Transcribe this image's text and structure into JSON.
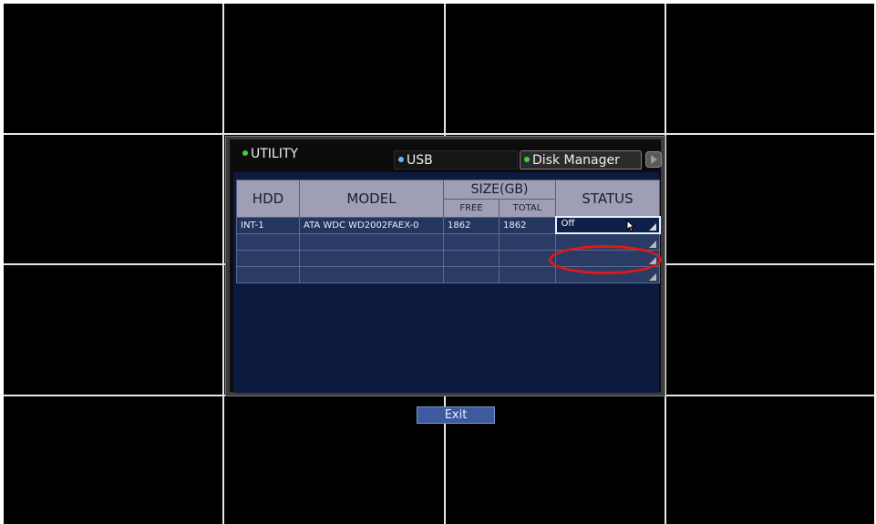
{
  "dialog": {
    "title": "UTILITY",
    "tabs": [
      {
        "label": "USB"
      },
      {
        "label": "Disk Manager"
      }
    ],
    "exit_label": "Exit"
  },
  "table": {
    "headers": {
      "hdd": "HDD",
      "model": "MODEL",
      "size": "SIZE(GB)",
      "free": "FREE",
      "total": "TOTAL",
      "status": "STATUS"
    },
    "rows": [
      {
        "hdd": "INT-1",
        "model": "ATA WDC WD2002FAEX-0",
        "free": "1862",
        "total": "1862",
        "status": "Off"
      },
      {
        "hdd": "",
        "model": "",
        "free": "",
        "total": "",
        "status": ""
      },
      {
        "hdd": "",
        "model": "",
        "free": "",
        "total": "",
        "status": ""
      },
      {
        "hdd": "",
        "model": "",
        "free": "",
        "total": "",
        "status": ""
      }
    ]
  },
  "colors": {
    "grid_line": "#e6e6e6",
    "title_dot": "#3ecf3e",
    "usb_dot": "#6fb3ff",
    "disk_dot": "#3ecf3e",
    "highlight": "#e01818",
    "header_bg": "#9e9fb7",
    "content_bg": "#0d1a40"
  },
  "icons": {
    "tab_next": "chevron-right-icon",
    "status_dropdown": "dropdown-corner-icon",
    "cursor": "mouse-pointer-icon"
  }
}
